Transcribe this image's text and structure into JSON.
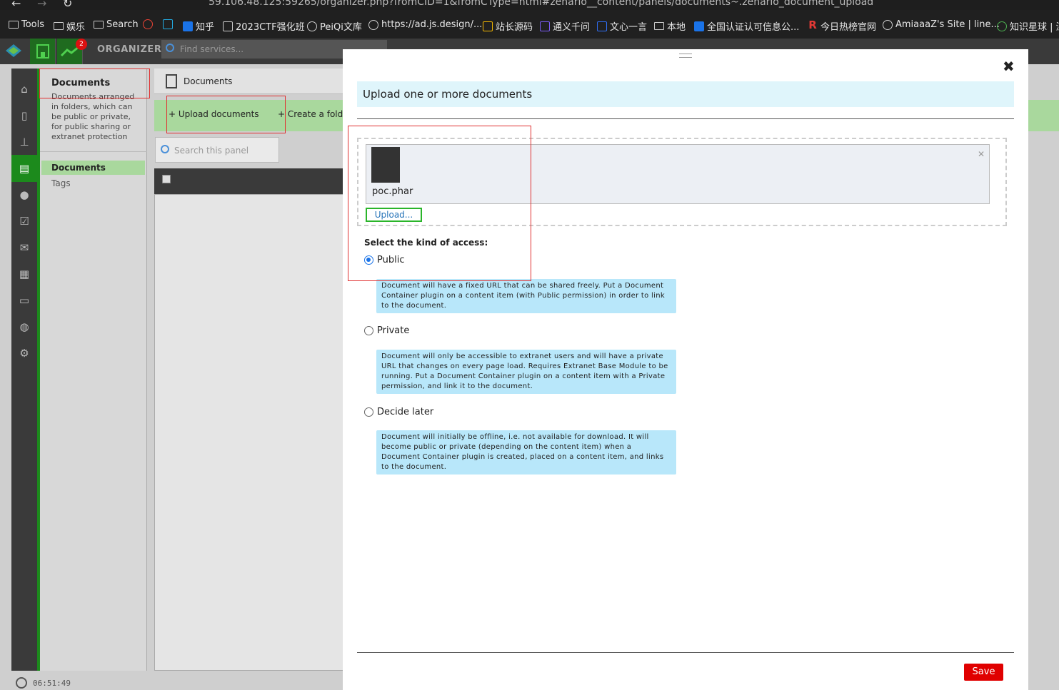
{
  "browser": {
    "url": "59.106.48.125:59265/organizer.php?fromCID=1&fromCType=html#zenario__content/panels/documents~.zenario_document_upload",
    "bookmarks": [
      {
        "label": "Tools",
        "icon": "folder-icon"
      },
      {
        "label": "娱乐",
        "icon": "folder-icon"
      },
      {
        "label": "Search",
        "icon": "folder-icon"
      },
      {
        "label": "",
        "icon": "google-icon"
      },
      {
        "label": "",
        "icon": "bilibili-icon"
      },
      {
        "label": "知乎",
        "icon": "zhihu-icon"
      },
      {
        "label": "2023CTF强化班",
        "icon": "link-icon"
      },
      {
        "label": "PeiQi文库",
        "icon": "globe-icon"
      },
      {
        "label": "https://ad.js.design/...",
        "icon": "link-icon"
      },
      {
        "label": "站长源码",
        "icon": "link-icon"
      },
      {
        "label": "通义千问",
        "icon": "link-icon"
      },
      {
        "label": "文心一言",
        "icon": "link-icon"
      },
      {
        "label": "本地",
        "icon": "folder-icon"
      },
      {
        "label": "全国认证认可信息公...",
        "icon": "link-icon"
      },
      {
        "label": "今日热榜官网",
        "icon": "r-icon"
      },
      {
        "label": "AmiaaaZ's Site | line...",
        "icon": "globe-icon"
      },
      {
        "label": "知识星球 | 深",
        "icon": "link-icon"
      }
    ]
  },
  "organizer": {
    "title": "ORGANIZER",
    "badge": "2",
    "find_placeholder": "Find services..."
  },
  "panel": {
    "title": "Documents",
    "description": "Documents arranged in folders, which can be public or private, for public sharing or extranet protection",
    "items": [
      "Documents",
      "Tags"
    ]
  },
  "main": {
    "header": "Documents",
    "actions": [
      "+ Upload documents",
      "+ Create a folde"
    ],
    "search_placeholder": "Search this panel"
  },
  "status": {
    "time": "06:51:49"
  },
  "modal": {
    "title": "Upload one or more documents",
    "file_name": "poc.phar",
    "upload_label": "Upload...",
    "access_label": "Select the kind of access:",
    "options": [
      {
        "label": "Public",
        "selected": true,
        "note": "Document will have a fixed URL that can be shared freely. Put a Document Container plugin on a content item (with Public permission) in order to link to the document."
      },
      {
        "label": "Private",
        "selected": false,
        "note": "Document will only be accessible to extranet users and will have a private URL that changes on every page load. Requires Extranet Base Module to be running. Put a Document Container plugin on a content item with a Private permission, and link it to the document."
      },
      {
        "label": "Decide later",
        "selected": false,
        "note": "Document will initially be offline, i.e. not available for download. It will become public or private (depending on the content item) when a Document Container plugin is created, placed on a content item, and links to the document."
      }
    ],
    "save_label": "Save"
  },
  "colors": {
    "accent_green": "#1c8a1c",
    "save_red": "#e00000",
    "note_blue": "#b8e7fa",
    "highlight_red": "#e03030"
  }
}
